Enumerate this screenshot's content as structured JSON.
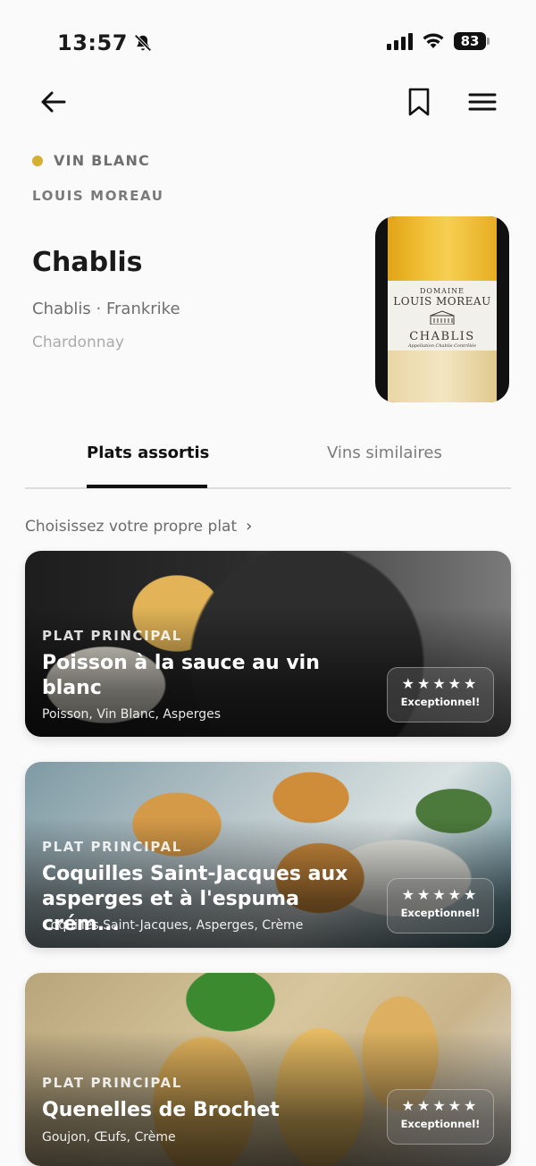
{
  "status_bar": {
    "time": "13:57",
    "battery": "83"
  },
  "wine": {
    "type_label": "VIN BLANC",
    "type_color": "#d4b033",
    "producer": "LOUIS MOREAU",
    "name": "Chablis",
    "region": "Chablis · Frankrike",
    "grape": "Chardonnay",
    "bottle_label": {
      "line1": "DOMAINE",
      "line2": "LOUIS MOREAU",
      "line3": "CHABLIS",
      "line4": "Appellation Chablis Contrôlée"
    }
  },
  "tabs": [
    {
      "label": "Plats assortis",
      "active": true
    },
    {
      "label": "Vins similaires",
      "active": false
    }
  ],
  "choose_dish": {
    "label": "Choisissez votre propre plat",
    "chevron": "›"
  },
  "dishes": [
    {
      "category": "PLAT PRINCIPAL",
      "title": "Poisson à la sauce au vin blanc",
      "ingredients": "Poisson, Vin Blanc, Asperges",
      "stars": "★★★★★",
      "verdict": "Exceptionnel!"
    },
    {
      "category": "PLAT PRINCIPAL",
      "title": "Coquilles Saint-Jacques aux asperges et à l'espuma crém...",
      "ingredients": "Coquilles Saint-Jacques, Asperges, Crème",
      "stars": "★★★★★",
      "verdict": "Exceptionnel!"
    },
    {
      "category": "PLAT PRINCIPAL",
      "title": "Quenelles de Brochet",
      "ingredients": "Goujon, Œufs, Crème",
      "stars": "★★★★★",
      "verdict": "Exceptionnel!"
    }
  ],
  "icons": [
    "back-arrow-icon",
    "bookmark-icon",
    "menu-icon",
    "bell-muted-icon",
    "signal-icon",
    "wifi-icon",
    "battery-icon",
    "chevron-right-icon",
    "star-icon"
  ]
}
